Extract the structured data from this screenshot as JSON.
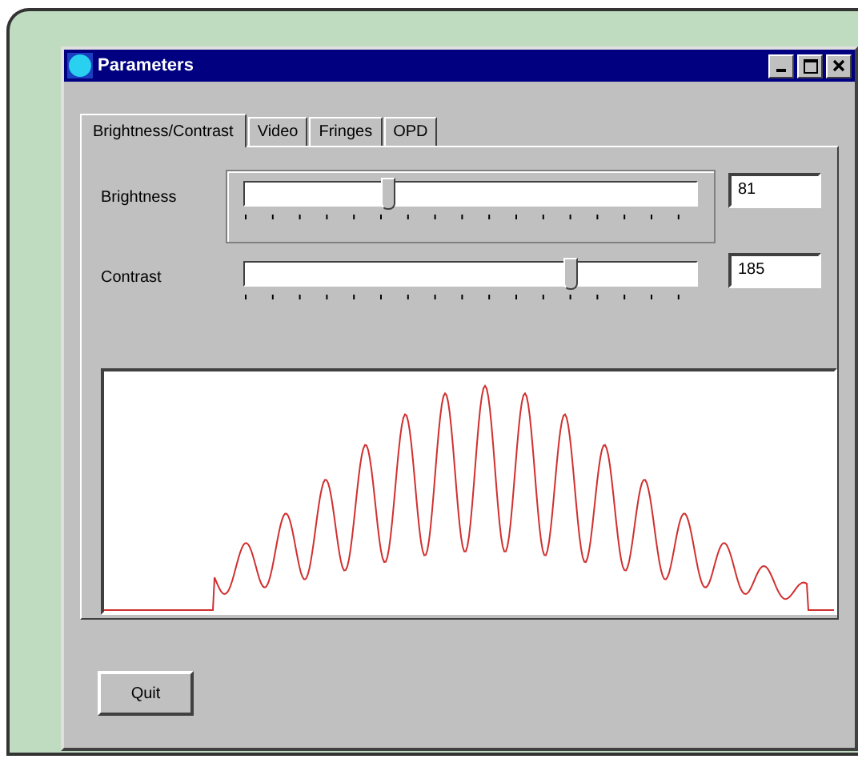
{
  "window": {
    "title": "Parameters"
  },
  "tabs": [
    {
      "label": "Brightness/Contrast",
      "selected": true
    },
    {
      "label": "Video",
      "selected": false
    },
    {
      "label": "Fringes",
      "selected": false
    },
    {
      "label": "OPD",
      "selected": false
    }
  ],
  "sliders": [
    {
      "label": "Brightness",
      "level": 0.32,
      "value": "81",
      "focused": true
    },
    {
      "label": "Contrast",
      "level": 0.725,
      "value": "185",
      "focused": false
    }
  ],
  "buttons": [
    "Quit"
  ]
}
